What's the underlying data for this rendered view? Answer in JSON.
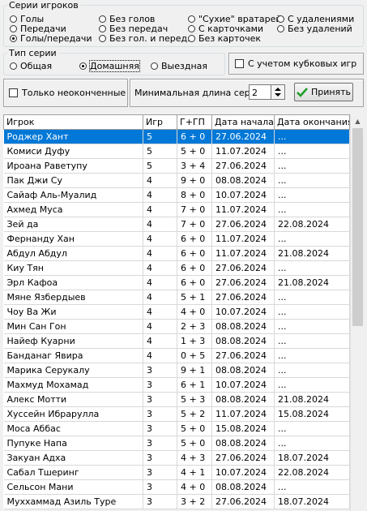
{
  "series_group": {
    "legend": "Серии игроков",
    "options": [
      {
        "label": "Голы",
        "checked": false
      },
      {
        "label": "Передачи",
        "checked": false
      },
      {
        "label": "Голы/передачи",
        "checked": true
      },
      {
        "label": "Без голов",
        "checked": false
      },
      {
        "label": "Без передач",
        "checked": false
      },
      {
        "label": "Без гол. и перед.",
        "checked": false
      },
      {
        "label": "\"Сухие\" вратарей",
        "checked": false
      },
      {
        "label": "С карточками",
        "checked": false
      },
      {
        "label": "Без карточек",
        "checked": false
      },
      {
        "label": "С удалениями",
        "checked": false
      },
      {
        "label": "Без удалений",
        "checked": false
      }
    ]
  },
  "type_group": {
    "legend": "Тип серии",
    "options": [
      {
        "label": "Общая",
        "checked": false
      },
      {
        "label": "Домашняя",
        "checked": true
      },
      {
        "label": "Выездная",
        "checked": false
      }
    ]
  },
  "cup_games_label": "С учетом кубковых игр",
  "unfinished_label": "Только неоконченные",
  "min_length_label": "Минимальная длина серии",
  "min_length_value": "2",
  "apply_label": "Принять",
  "table": {
    "columns": [
      "Игрок",
      "Игр",
      "Г+ГП",
      "Дата начала",
      "Дата окончания"
    ],
    "rows": [
      [
        "Роджер Хант",
        "5",
        "6 + 0",
        "27.06.2024",
        "..."
      ],
      [
        "Комиси Дуфу",
        "5",
        "5 + 0",
        "11.07.2024",
        "..."
      ],
      [
        "Ироана Раветупу",
        "5",
        "3 + 4",
        "27.06.2024",
        "..."
      ],
      [
        "Пак Джи Су",
        "4",
        "9 + 0",
        "08.08.2024",
        "..."
      ],
      [
        "Сайаф Аль-Муалид",
        "4",
        "8 + 0",
        "10.07.2024",
        "..."
      ],
      [
        "Ахмед Муса",
        "4",
        "7 + 0",
        "11.07.2024",
        "..."
      ],
      [
        "Зей да",
        "4",
        "7 + 0",
        "27.06.2024",
        "22.08.2024"
      ],
      [
        "Фернанду Хан",
        "4",
        "6 + 0",
        "11.07.2024",
        "..."
      ],
      [
        "Абдул Абдул",
        "4",
        "6 + 0",
        "11.07.2024",
        "21.08.2024"
      ],
      [
        "Киу Тян",
        "4",
        "6 + 0",
        "27.06.2024",
        "..."
      ],
      [
        "Эрл Кафоа",
        "4",
        "6 + 0",
        "27.06.2024",
        "21.08.2024"
      ],
      [
        "Мяне Язбердыев",
        "4",
        "5 + 1",
        "27.06.2024",
        "..."
      ],
      [
        "Чоу Ва Жи",
        "4",
        "4 + 0",
        "10.07.2024",
        "..."
      ],
      [
        "Мин Сан Гон",
        "4",
        "2 + 3",
        "08.08.2024",
        "..."
      ],
      [
        "Найеф Куарни",
        "4",
        "1 + 3",
        "08.08.2024",
        "..."
      ],
      [
        "Банданаг Явира",
        "4",
        "0 + 5",
        "27.06.2024",
        "..."
      ],
      [
        "Марика Серукалу",
        "3",
        "9 + 1",
        "08.08.2024",
        "..."
      ],
      [
        "Махмуд Мохамад",
        "3",
        "6 + 1",
        "10.07.2024",
        "..."
      ],
      [
        "Алекс Мотти",
        "3",
        "5 + 3",
        "08.08.2024",
        "21.08.2024"
      ],
      [
        "Хуссейн Ибраруллa",
        "3",
        "5 + 2",
        "11.07.2024",
        "15.08.2024"
      ],
      [
        "Моса Аббас",
        "3",
        "5 + 0",
        "15.08.2024",
        "..."
      ],
      [
        "Пупуке Напа",
        "3",
        "5 + 0",
        "08.08.2024",
        "..."
      ],
      [
        "Закуан Адха",
        "3",
        "4 + 3",
        "27.06.2024",
        "18.07.2024"
      ],
      [
        "Сабал Тшеринг",
        "3",
        "4 + 1",
        "10.07.2024",
        "22.08.2024"
      ],
      [
        "Сельсон Мани",
        "3",
        "4 + 0",
        "08.08.2024",
        "..."
      ],
      [
        "Муххаммад Азиль Туре",
        "3",
        "3 + 2",
        "27.06.2024",
        "18.07.2024"
      ]
    ]
  },
  "colors": {
    "selection": "#0078d7",
    "accept_check": "#1e9e2a"
  },
  "icons": [
    "accept-check-icon",
    "spin-arrows-icon",
    "scroll-up-icon"
  ]
}
